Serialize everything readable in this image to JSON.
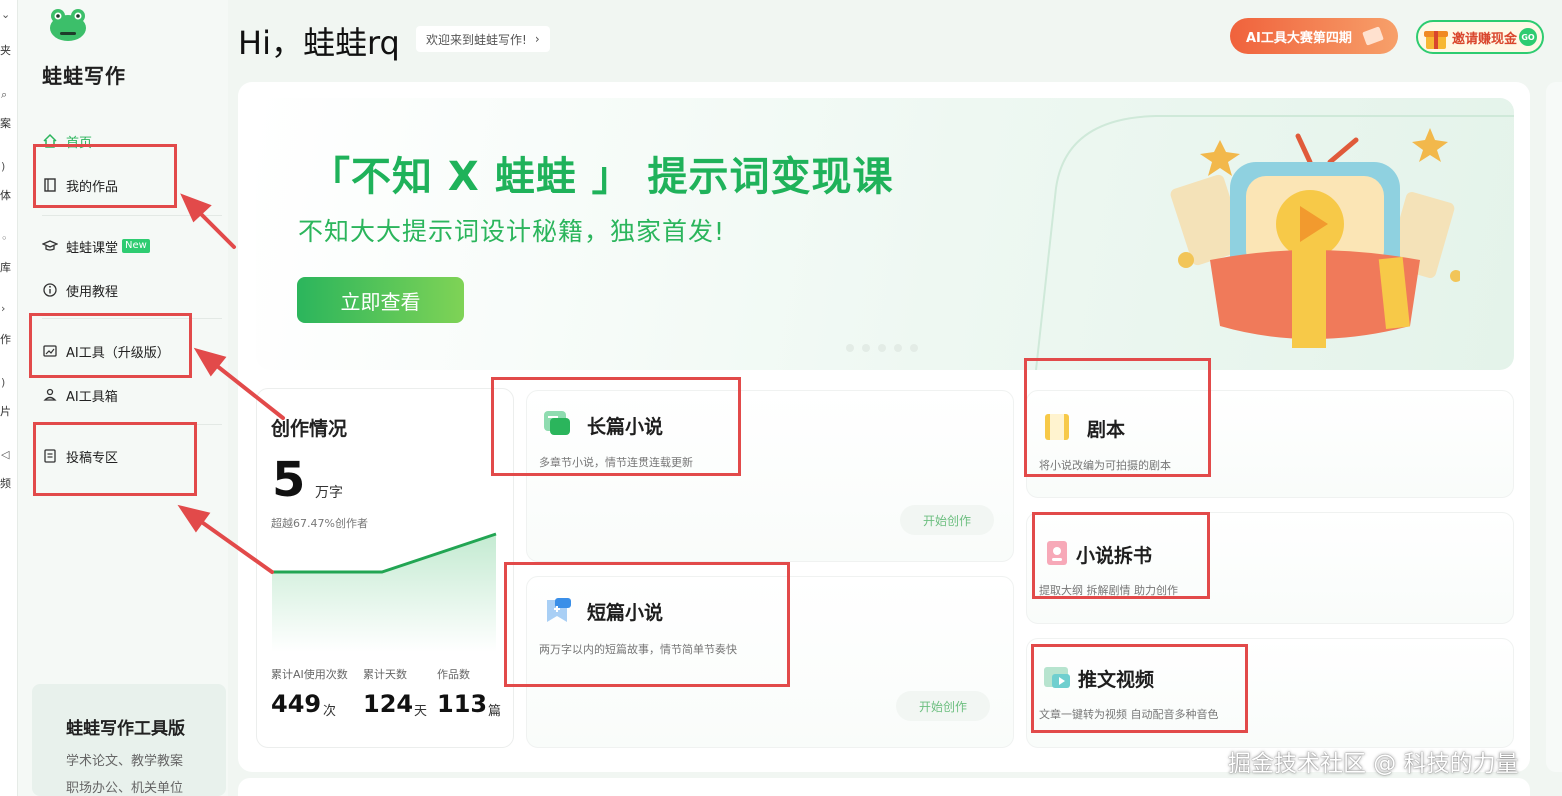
{
  "edge_strip": {
    "labels": [
      "夹",
      "案",
      "体",
      "库",
      "作",
      "片",
      "频"
    ]
  },
  "sidebar": {
    "brand": "蛙蛙写作",
    "items": [
      {
        "label": "首页",
        "icon": "home-icon"
      },
      {
        "label": "我的作品",
        "icon": "book-icon"
      },
      {
        "label": "蛙蛙课堂",
        "icon": "graduation-cap-icon",
        "badge": "New"
      },
      {
        "label": "使用教程",
        "icon": "info-icon"
      },
      {
        "label": "AI工具（升级版）",
        "icon": "image-edit-icon"
      },
      {
        "label": "AI工具箱",
        "icon": "toolbox-icon"
      },
      {
        "label": "投稿专区",
        "icon": "submit-icon"
      }
    ],
    "promo": {
      "title": "蛙蛙写作工具版",
      "line1": "学术论文、教学教案",
      "line2": "职场办公、机关单位"
    }
  },
  "header": {
    "greeting": "Hi，蛙蛙rq",
    "welcome": "欢迎来到蛙蛙写作!",
    "welcome_chevron": "›",
    "contest": "AI工具大赛第四期",
    "invite": "邀请赚现金"
  },
  "banner": {
    "title": "「不知 X 蛙蛙 」 提示词变现课",
    "subtitle": "不知大大提示词设计秘籍，独家首发!",
    "button": "立即查看"
  },
  "stats": {
    "title": "创作情况",
    "total_value": "5",
    "total_unit": "万字",
    "note": "超越67.47%创作者",
    "trend": [
      0.0,
      0.0,
      1.0
    ],
    "ai_label": "累计AI使用次数",
    "ai_value": "449",
    "ai_suffix": "次",
    "days_label": "累计天数",
    "days_value": "124",
    "days_suffix": "天",
    "works_label": "作品数",
    "works_value": "113",
    "works_suffix": "篇"
  },
  "features": {
    "long_novel": {
      "title": "长篇小说",
      "desc": "多章节小说，情节连贯连载更新",
      "action": "开始创作"
    },
    "short_story": {
      "title": "短篇小说",
      "desc": "两万字以内的短篇故事，情节简单节奏快",
      "action": "开始创作"
    },
    "script": {
      "title": "剧本",
      "desc": "将小说改编为可拍摄的剧本"
    },
    "breakdown": {
      "title": "小说拆书",
      "desc": "提取大纲 拆解剧情 助力创作"
    },
    "video": {
      "title": "推文视频",
      "desc": "文章一键转为视频 自动配音多种音色"
    }
  },
  "watermark": "掘金技术社区 @ 科技的力量",
  "colors": {
    "brand_green": "#2bb55c",
    "annotation_red": "#e24a4a",
    "contest_orange": "#f0623c"
  }
}
